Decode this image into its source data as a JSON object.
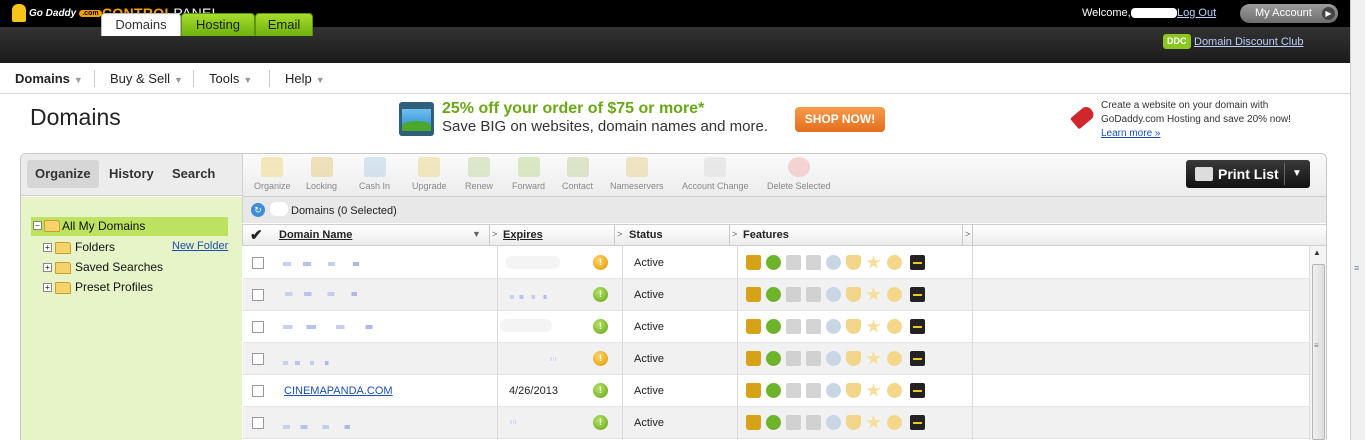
{
  "header": {
    "logo_text": "Go Daddy",
    "title_part1": "CONTROL",
    "title_part2": "PANEL",
    "welcome": "Welcome,",
    "logout": "Log Out",
    "my_account": "My Account"
  },
  "tabs": [
    {
      "label": "Domains"
    },
    {
      "label": "Hosting"
    },
    {
      "label": "Email"
    }
  ],
  "ddc": {
    "badge": "DDC",
    "link": "Domain Discount Club"
  },
  "menu": [
    "Domains",
    "Buy & Sell",
    "Tools",
    "Help"
  ],
  "page": {
    "title": "Domains"
  },
  "promo": {
    "line1": "25% off your order of $75 or more*",
    "line2": "Save BIG on websites, domain names and more.",
    "button": "SHOP NOW!"
  },
  "hosting_promo": {
    "text": "Create a website on your domain with GoDaddy.com Hosting and save 20% now!",
    "link": "Learn more »"
  },
  "left_tabs": [
    "Organize",
    "History",
    "Search"
  ],
  "tree": {
    "root": "All My Domains",
    "items": [
      "Folders",
      "Saved Searches",
      "Preset Profiles"
    ],
    "new_folder": "New Folder"
  },
  "toolbar": [
    "Organize",
    "Locking",
    "Cash In",
    "Upgrade",
    "Renew",
    "Forward",
    "Contact",
    "Nameservers",
    "Account Change",
    "Delete Selected"
  ],
  "print_list": "Print List",
  "grid": {
    "selected_text": "Domains (0 Selected)",
    "columns": [
      "Domain Name",
      "Expires",
      "Status",
      "Features"
    ],
    "rows": [
      {
        "domain": "",
        "expires": "",
        "status": "Active",
        "status_color": "orange"
      },
      {
        "domain": "",
        "expires": "",
        "status": "Active",
        "status_color": "green"
      },
      {
        "domain": "",
        "expires": "",
        "status": "Active",
        "status_color": "green"
      },
      {
        "domain": "",
        "expires": "",
        "status": "Active",
        "status_color": "orange"
      },
      {
        "domain": "CINEMAPANDA.COM",
        "expires": "4/26/2013",
        "status": "Active",
        "status_color": "green"
      },
      {
        "domain": "",
        "expires": "",
        "status": "Active",
        "status_color": "green"
      }
    ]
  },
  "colors": {
    "accent_green": "#8cc620",
    "tab_green": "#6db20c",
    "link": "#1a4fb5",
    "shop_orange": "#e36f1c"
  }
}
